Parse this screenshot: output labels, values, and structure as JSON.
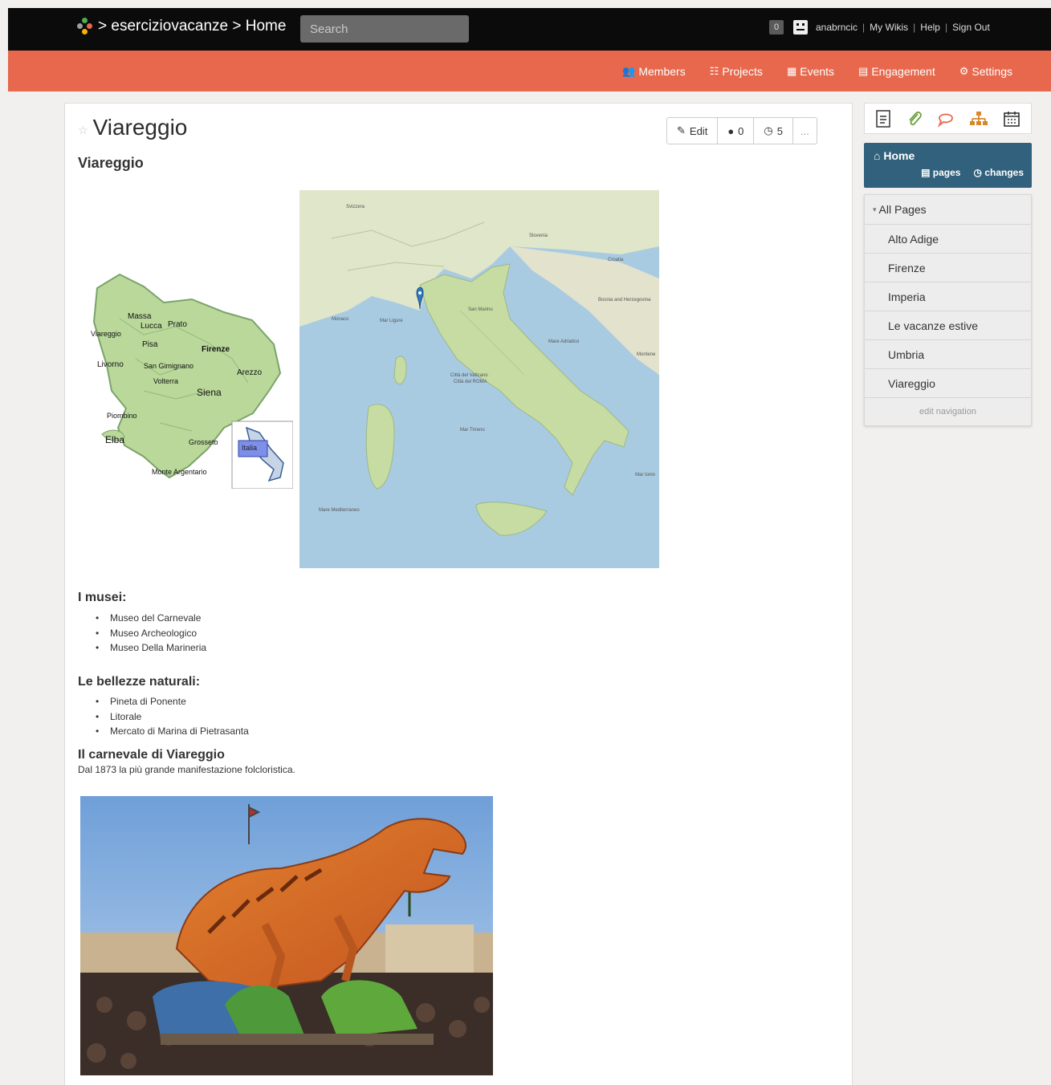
{
  "header": {
    "breadcrumb": "> eserciziovacanze > Home",
    "search_placeholder": "Search",
    "notification_count": "0",
    "username": "anabrncic",
    "links": [
      "My Wikis",
      "Help",
      "Sign Out"
    ]
  },
  "nav": {
    "items": [
      {
        "label": "Members",
        "icon": "members-icon"
      },
      {
        "label": "Projects",
        "icon": "projects-icon"
      },
      {
        "label": "Events",
        "icon": "calendar-icon"
      },
      {
        "label": "Engagement",
        "icon": "engagement-icon"
      },
      {
        "label": "Settings",
        "icon": "gear-icon"
      }
    ],
    "accent": "#e7684d"
  },
  "page": {
    "title": "Viareggio",
    "subtitle": "Viareggio",
    "edit_label": "Edit",
    "comments_count": "0",
    "revisions_count": "5",
    "more_label": "...",
    "tuscany_labels": [
      "Massa",
      "Lucca",
      "Prato",
      "Viareggio",
      "Pisa",
      "Firenze",
      "Livorno",
      "San Gimignano",
      "Volterra",
      "Arezzo",
      "Siena",
      "Piombino",
      "Elba",
      "Grosseto",
      "Monte Argentario",
      "Italia"
    ],
    "italy_labels": [
      "Svizzera",
      "Slovenia",
      "Croatia",
      "Bosnia and Herzegovina",
      "Città del Vaticano",
      "Città del ROMA",
      "Monaco",
      "Mar Ligure",
      "Mar Tirreno",
      "Mare Adriatico",
      "Montene",
      "Mar Ionio",
      "Mare Mediterraneo",
      "San Marino"
    ],
    "museums_heading": "I musei:",
    "museums": [
      "Museo del Carnevale",
      "Museo Archeologico",
      "Museo Della Marineria"
    ],
    "nature_heading": "Le bellezze naturali:",
    "nature": [
      "Pineta di Ponente",
      "Litorale",
      "Mercato di Marina di Pietrasanta"
    ],
    "carnival_heading": "Il carnevale di Viareggio",
    "carnival_desc": "Dal 1873 la più grande manifestazione folcloristica."
  },
  "sidebar": {
    "tools": [
      "page-icon",
      "attachment-icon",
      "comment-icon",
      "hierarchy-icon",
      "calendar-icon"
    ],
    "home_label": "Home",
    "pages_link": "pages",
    "changes_link": "changes",
    "home_color": "#31617c",
    "all_pages_label": "All Pages",
    "pages": [
      "Alto Adige",
      "Firenze",
      "Imperia",
      "Le vacanze estive",
      "Umbria",
      "Viareggio"
    ],
    "edit_nav": "edit navigation"
  }
}
